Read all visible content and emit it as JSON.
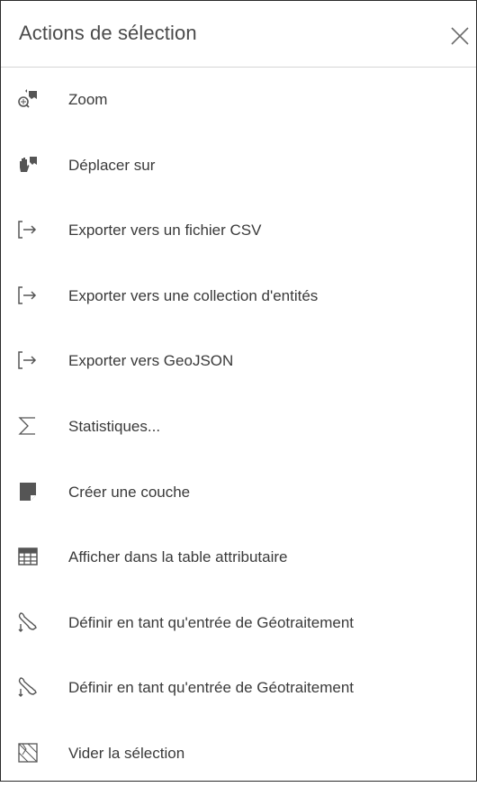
{
  "header": {
    "title": "Actions de sélection",
    "close_icon": "close-icon"
  },
  "menu": {
    "items": [
      {
        "label": "Zoom",
        "icon": "zoom-to-icon"
      },
      {
        "label": "Déplacer sur",
        "icon": "pan-to-icon"
      },
      {
        "label": "Exporter vers un fichier CSV",
        "icon": "export-icon"
      },
      {
        "label": "Exporter vers une collection d'entités",
        "icon": "export-icon"
      },
      {
        "label": "Exporter vers GeoJSON",
        "icon": "export-icon"
      },
      {
        "label": "Statistiques...",
        "icon": "sigma-icon"
      },
      {
        "label": "Créer une couche",
        "icon": "create-layer-icon"
      },
      {
        "label": "Afficher dans la table attributaire",
        "icon": "table-icon"
      },
      {
        "label": "Définir en tant qu'entrée de Géotraitement",
        "icon": "geoprocessing-icon"
      },
      {
        "label": "Définir en tant qu'entrée de Géotraitement",
        "icon": "geoprocessing-icon"
      },
      {
        "label": "Vider la sélection",
        "icon": "clear-selection-icon"
      }
    ]
  },
  "colors": {
    "icon": "#555555",
    "text": "#3a3a3a",
    "divider": "#d6d6d6"
  }
}
